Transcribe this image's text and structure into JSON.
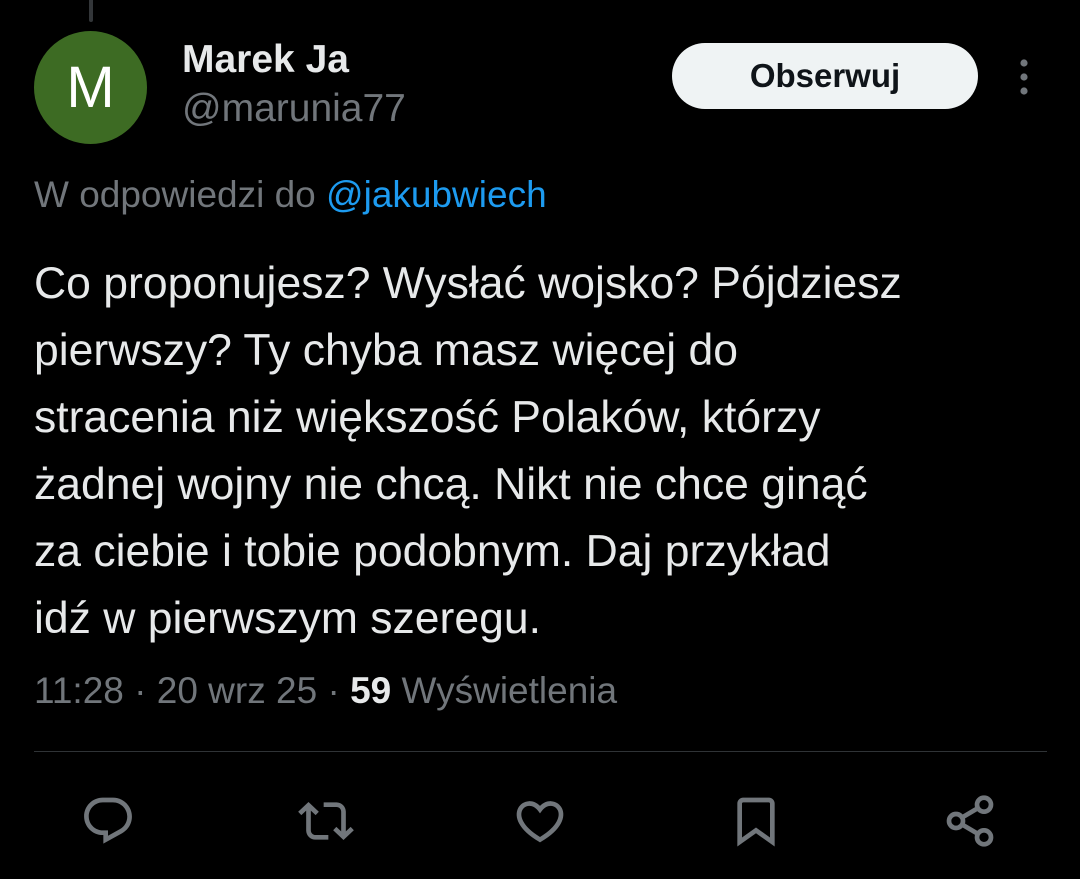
{
  "author": {
    "avatar_letter": "M",
    "avatar_color": "#3d6b23",
    "display_name": "Marek Ja",
    "handle": "@marunia77"
  },
  "follow_button": {
    "label": "Obserwuj"
  },
  "more_menu": {
    "icon": "more-vertical-icon"
  },
  "reply_context": {
    "prefix": "W odpowiedzi do",
    "mention": "@jakubwiech"
  },
  "tweet": {
    "lines": [
      "Co proponujesz? Wysłać wojsko? Pójdziesz",
      "pierwszy? Ty chyba masz więcej do",
      "stracenia niż większość Polaków, którzy",
      "żadnej wojny nie chcą. Nikt nie chce ginąć",
      "za ciebie i tobie podobnym. Daj przykład",
      "idź w pierwszym szeregu."
    ]
  },
  "meta": {
    "time": "11:28",
    "separator": " · ",
    "date": "20 wrz 25",
    "views_count": "59",
    "views_label": "Wyświetlenia"
  },
  "actions": [
    {
      "name": "reply",
      "icon": "reply-icon"
    },
    {
      "name": "retweet",
      "icon": "retweet-icon"
    },
    {
      "name": "like",
      "icon": "heart-icon"
    },
    {
      "name": "bookmark",
      "icon": "bookmark-icon"
    },
    {
      "name": "share",
      "icon": "share-icon"
    }
  ],
  "colors": {
    "background": "#000000",
    "text_primary": "#e7e9ea",
    "text_secondary": "#71767b",
    "link": "#1d9bf0",
    "button_bg": "#eff3f4",
    "divider": "#2f3336"
  }
}
